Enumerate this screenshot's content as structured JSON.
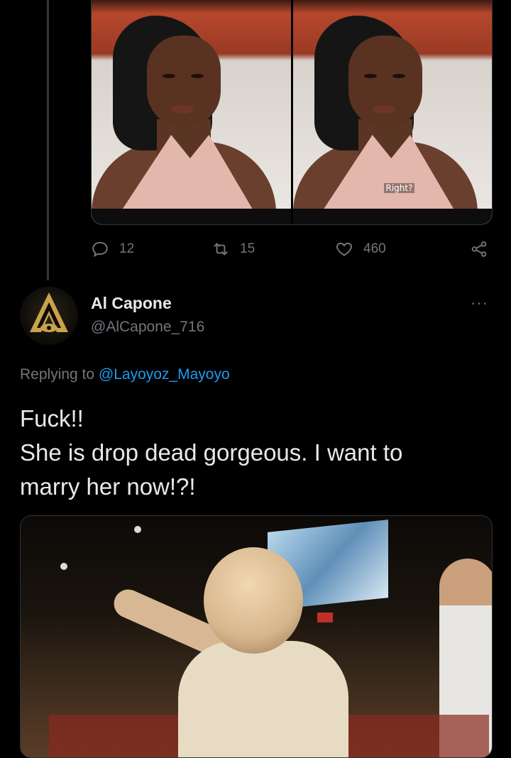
{
  "previous_tweet": {
    "media": {
      "subtitle_text": "Right?"
    },
    "actions": {
      "reply_count": "12",
      "retweet_count": "15",
      "like_count": "460"
    }
  },
  "reply_tweet": {
    "author": {
      "display_name": "Al Capone",
      "handle": "@AlCapone_716"
    },
    "more_label": "···",
    "replying_to": {
      "prefix": "Replying to ",
      "mention": "@Layoyoz_Mayoyo"
    },
    "text_lines": [
      "Fuck!!",
      "She is drop dead gorgeous. I want to",
      "marry her now!?!"
    ]
  },
  "colors": {
    "background": "#000000",
    "text_primary": "#e7e9ea",
    "text_secondary": "#71767b",
    "link": "#1d9bf0",
    "border": "#2f3336"
  },
  "icons": [
    "reply-icon",
    "retweet-icon",
    "like-icon",
    "share-icon",
    "more-icon"
  ]
}
